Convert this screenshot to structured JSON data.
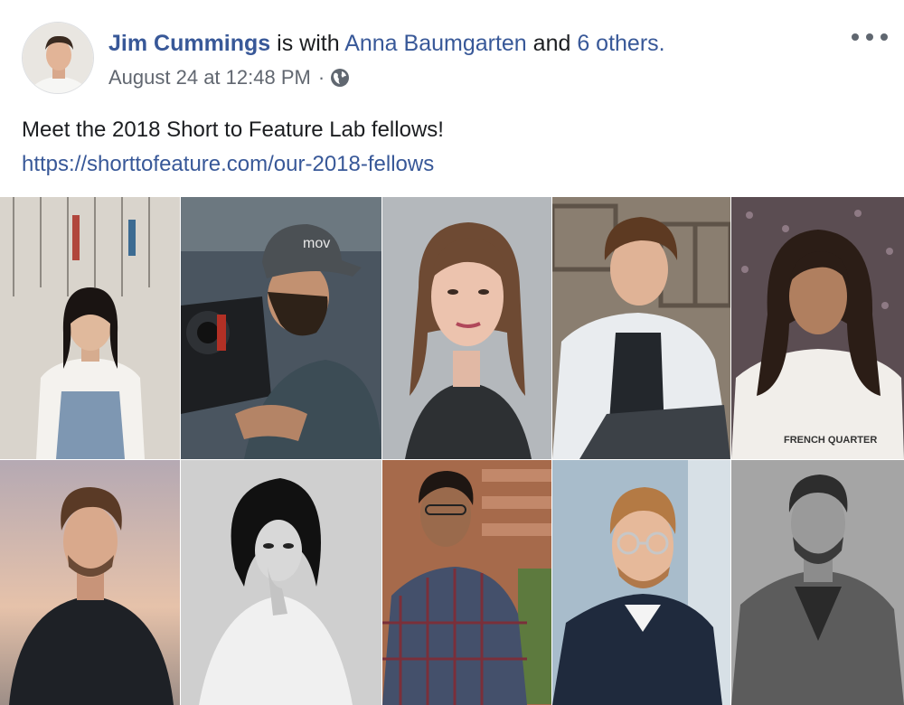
{
  "post": {
    "author": "Jim Cummings",
    "with_text": " is with ",
    "tagged": "Anna Baumgarten",
    "and_text": " and ",
    "others": "6 others.",
    "timestamp": "August 24 at 12:48 PM",
    "separator": "·",
    "audience_icon": "globe-icon",
    "more_icon": "more-options-icon",
    "text": "Meet the 2018 Short to Feature Lab fellows!",
    "link": "https://shorttofeature.com/our-2018-fellows"
  },
  "photo_grid": {
    "rows": 2,
    "columns": 5,
    "photos": [
      {
        "overlay_text": ""
      },
      {
        "overlay_text": "mov"
      },
      {
        "overlay_text": ""
      },
      {
        "overlay_text": ""
      },
      {
        "overlay_text": "FRENCH QUARTER"
      },
      {
        "overlay_text": ""
      },
      {
        "overlay_text": ""
      },
      {
        "overlay_text": ""
      },
      {
        "overlay_text": ""
      },
      {
        "overlay_text": ""
      }
    ]
  },
  "colors": {
    "link": "#385898",
    "text": "#1c1e21",
    "meta": "#616770"
  }
}
